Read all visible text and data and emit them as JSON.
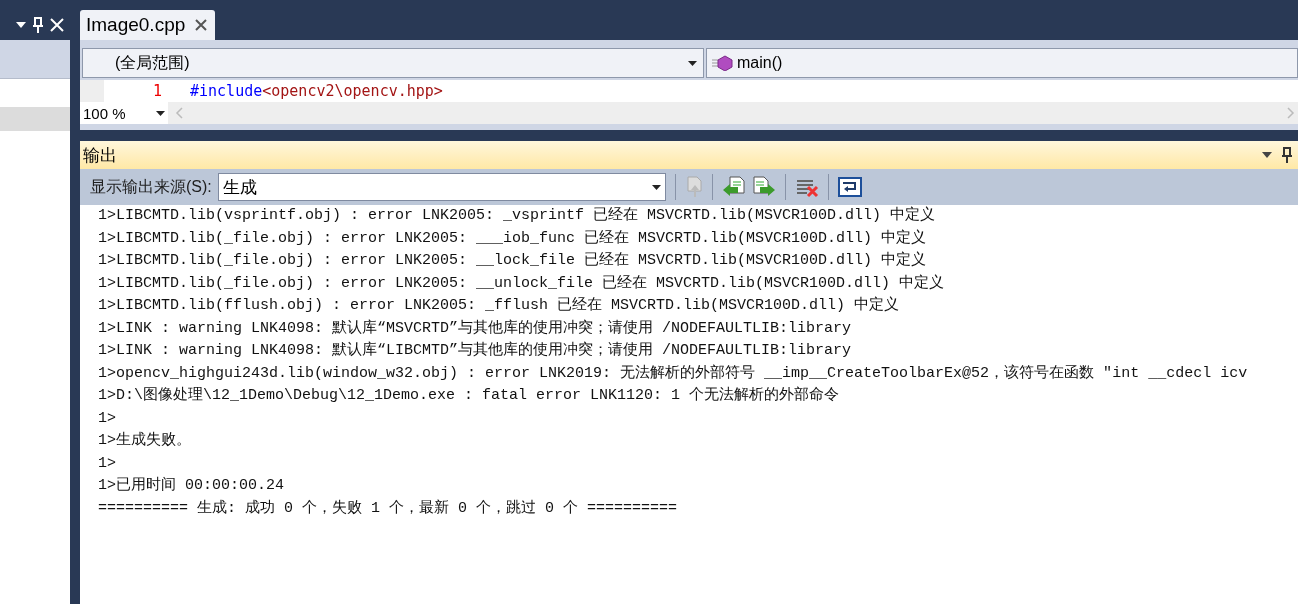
{
  "side_panel": {
    "rows": [
      {
        "selected": false
      },
      {
        "selected": true
      }
    ]
  },
  "editor": {
    "tabs": [
      {
        "label": "Image0.cpp",
        "selected": true
      }
    ],
    "scope": "(全局范围)",
    "member": "main()",
    "lines": [
      {
        "number": "1",
        "segments": [
          {
            "kind": "directive",
            "text": "#include"
          },
          {
            "kind": "string",
            "text": "<opencv2\\opencv.hpp>"
          }
        ]
      }
    ],
    "zoom": "100 %"
  },
  "output": {
    "title": "输出",
    "source_label": "显示输出来源(S):",
    "source": "生成",
    "lines": [
      "1>LIBCMTD.lib(vsprintf.obj) : error LNK2005: _vsprintf 已经在 MSVCRTD.lib(MSVCR100D.dll) 中定义",
      "1>LIBCMTD.lib(_file.obj) : error LNK2005: ___iob_func 已经在 MSVCRTD.lib(MSVCR100D.dll) 中定义",
      "1>LIBCMTD.lib(_file.obj) : error LNK2005: __lock_file 已经在 MSVCRTD.lib(MSVCR100D.dll) 中定义",
      "1>LIBCMTD.lib(_file.obj) : error LNK2005: __unlock_file 已经在 MSVCRTD.lib(MSVCR100D.dll) 中定义",
      "1>LIBCMTD.lib(fflush.obj) : error LNK2005: _fflush 已经在 MSVCRTD.lib(MSVCR100D.dll) 中定义",
      "1>LINK : warning LNK4098: 默认库“MSVCRTD”与其他库的使用冲突；请使用 /NODEFAULTLIB:library",
      "1>LINK : warning LNK4098: 默认库“LIBCMTD”与其他库的使用冲突；请使用 /NODEFAULTLIB:library",
      "1>opencv_highgui243d.lib(window_w32.obj) : error LNK2019: 无法解析的外部符号 __imp__CreateToolbarEx@52，该符号在函数 \"int __cdecl icv",
      "1>D:\\图像处理\\12_1Demo\\Debug\\12_1Demo.exe : fatal error LNK1120: 1 个无法解析的外部命令",
      "1>",
      "1>生成失败。",
      "1>",
      "1>已用时间 00:00:00.24",
      "========== 生成: 成功 0 个，失败 1 个，最新 0 个，跳过 0 个 =========="
    ]
  }
}
